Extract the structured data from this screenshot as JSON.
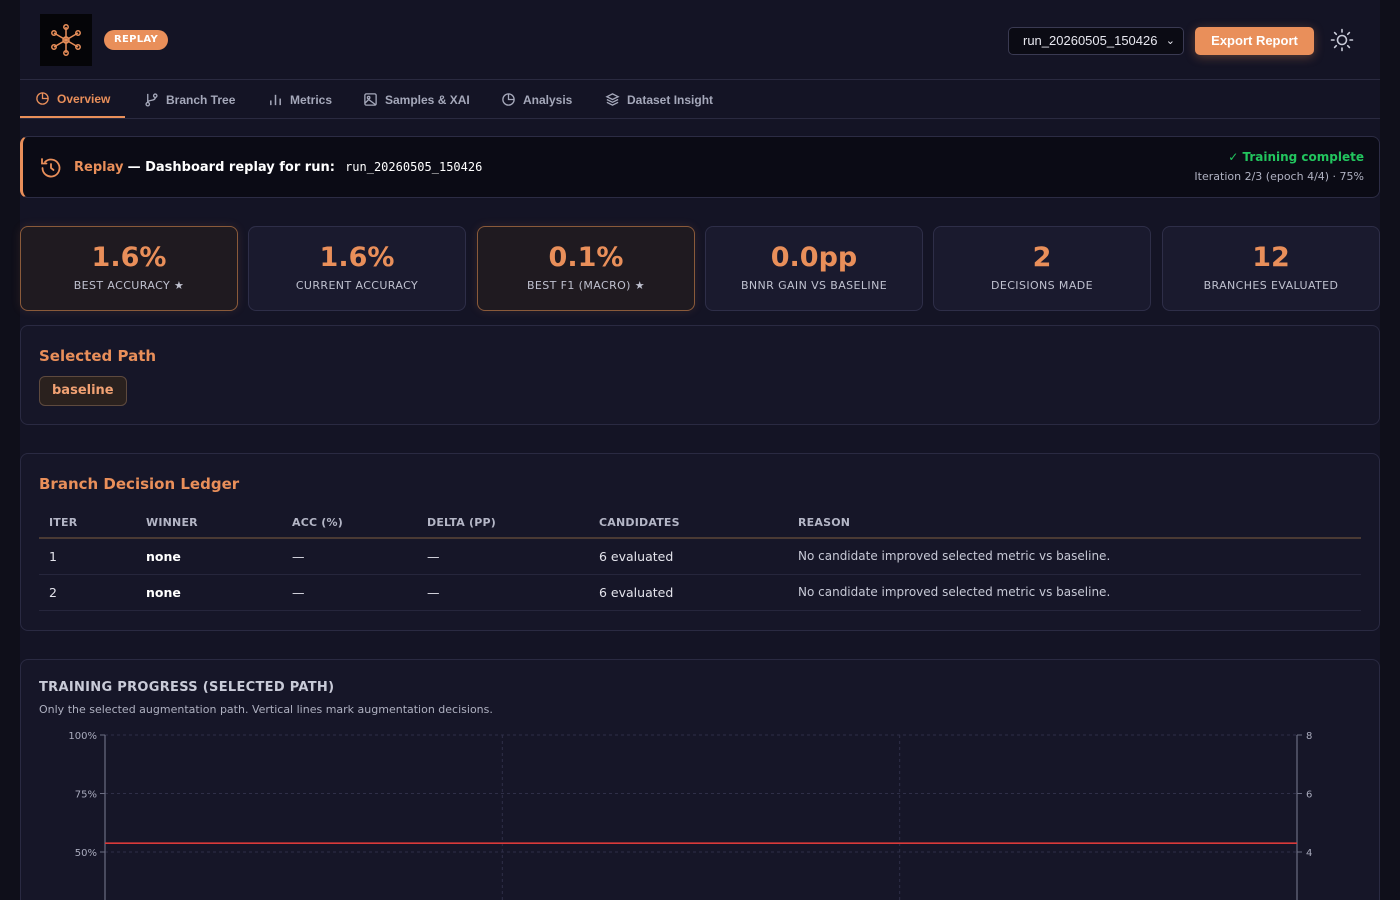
{
  "header": {
    "badge": "REPLAY",
    "run_select_value": "run_20260505_150426",
    "export_label": "Export Report",
    "accent": "#e98f5a"
  },
  "tabs": [
    {
      "label": "Overview",
      "icon": "pie-chart-icon",
      "active": true
    },
    {
      "label": "Branch Tree",
      "icon": "git-branch-icon"
    },
    {
      "label": "Metrics",
      "icon": "bar-chart-icon"
    },
    {
      "label": "Samples & XAI",
      "icon": "image-icon"
    },
    {
      "label": "Analysis",
      "icon": "pie-chart-icon"
    },
    {
      "label": "Dataset Insight",
      "icon": "layers-icon"
    }
  ],
  "banner": {
    "replay_word": "Replay",
    "description": "— Dashboard replay for run:",
    "run_id": "run_20260505_150426",
    "status": "✓ Training complete",
    "iteration": "Iteration 2/3 (epoch 4/4) · 75%"
  },
  "stats": [
    {
      "value": "1.6%",
      "label": "BEST ACCURACY ★"
    },
    {
      "value": "1.6%",
      "label": "CURRENT ACCURACY"
    },
    {
      "value": "0.1%",
      "label": "BEST F1 (MACRO) ★"
    },
    {
      "value": "0.0pp",
      "label": "BNNR GAIN VS BASELINE"
    },
    {
      "value": "2",
      "label": "DECISIONS MADE"
    },
    {
      "value": "12",
      "label": "BRANCHES EVALUATED"
    }
  ],
  "selected_path": {
    "title": "Selected Path",
    "chip": "baseline"
  },
  "ledger": {
    "title": "Branch Decision Ledger",
    "columns": [
      "ITER",
      "WINNER",
      "ACC (%)",
      "DELTA (PP)",
      "CANDIDATES",
      "REASON"
    ],
    "rows": [
      [
        "1",
        "none",
        "—",
        "—",
        "6 evaluated",
        "No candidate improved selected metric vs baseline."
      ],
      [
        "2",
        "none",
        "—",
        "—",
        "6 evaluated",
        "No candidate improved selected metric vs baseline."
      ]
    ]
  },
  "training_chart": {
    "title": "TRAINING PROGRESS (SELECTED PATH)",
    "subtitle": "Only the selected augmentation path. Vertical lines mark augmentation decisions.",
    "left_ticks": [
      "100%",
      "75%",
      "50%"
    ],
    "right_ticks": [
      "8",
      "6",
      "4"
    ],
    "line_color": "#d93a3a"
  },
  "chart_data": {
    "type": "line",
    "title": "TRAINING PROGRESS (SELECTED PATH)",
    "xlabel": "",
    "ylabel": "",
    "ylim": [
      0,
      100
    ],
    "y2lim": [
      0,
      8
    ],
    "grid": true,
    "series": [
      {
        "values": [
          4.3,
          4.3,
          4.3,
          4.3
        ]
      }
    ]
  }
}
